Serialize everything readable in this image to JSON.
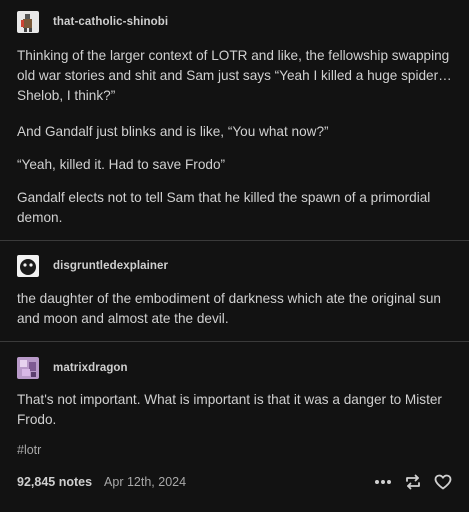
{
  "posts": [
    {
      "username": "that-catholic-shinobi",
      "paragraphs": [
        "Thinking of the larger context of LOTR and like, the fellowship swapping old war stories and shit and Sam just says “Yeah I killed a huge spider…Shelob, I think?”",
        "And Gandalf just blinks and is like, “You what now?”",
        "“Yeah, killed it. Had to save Frodo”",
        "Gandalf elects not to tell Sam that he killed the spawn of a primordial demon."
      ]
    },
    {
      "username": "disgruntledexplainer",
      "paragraphs": [
        "the daughter of the embodiment of darkness which ate the original sun and moon and almost ate the devil."
      ]
    },
    {
      "username": "matrixdragon",
      "paragraphs": [
        "That's not important. What is important is that it was a danger to Mister Frodo."
      ],
      "tag": "#lotr"
    }
  ],
  "footer": {
    "notes": "92,845 notes",
    "date": "Apr 12th, 2024"
  },
  "icons": {
    "more": "more-icon",
    "reblog": "reblog-icon",
    "like": "heart-icon"
  },
  "colors": {
    "background": "#121212",
    "separator": "#3a3a3a",
    "text": "#d0d0d0"
  }
}
